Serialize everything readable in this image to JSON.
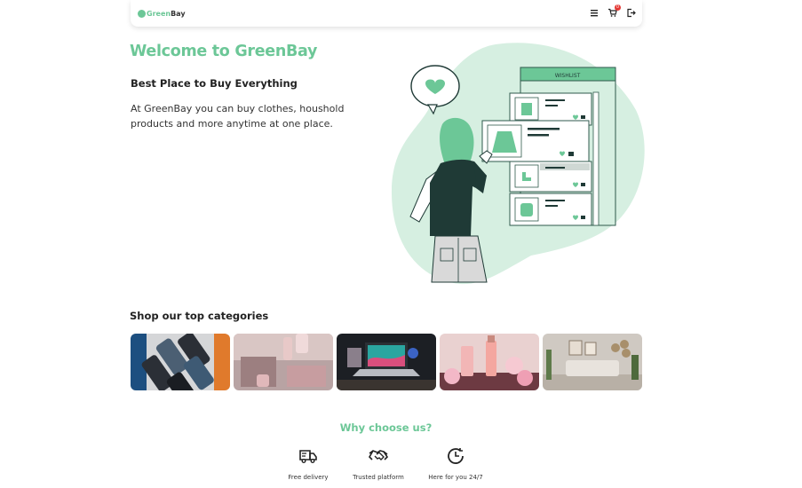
{
  "navbar": {
    "logo_green": "Green",
    "logo_bay": "Bay",
    "cart_count": "0",
    "icons": [
      "menu-icon",
      "cart-icon",
      "logout-icon"
    ]
  },
  "hero": {
    "title": "Welcome to GreenBay",
    "subtitle": "Best Place to Buy Everything",
    "description": "At GreenBay you can buy clothes, houshold products and more anytime at one place.",
    "wishlist_label": "WISHLIST"
  },
  "categories": {
    "title": "Shop our top categories",
    "items": [
      {
        "name": "phones"
      },
      {
        "name": "household"
      },
      {
        "name": "laptops"
      },
      {
        "name": "beauty"
      },
      {
        "name": "furniture"
      }
    ]
  },
  "why": {
    "title": "Why choose us?",
    "features": [
      {
        "label": "Free delivery",
        "icon": "truck-icon"
      },
      {
        "label": "Trusted platform",
        "icon": "handshake-icon"
      },
      {
        "label": "Here for you 24/7",
        "icon": "clock-icon"
      }
    ]
  },
  "colors": {
    "brand": "#6cc797",
    "blob": "#d6efe1",
    "dark": "#1f3a36"
  }
}
